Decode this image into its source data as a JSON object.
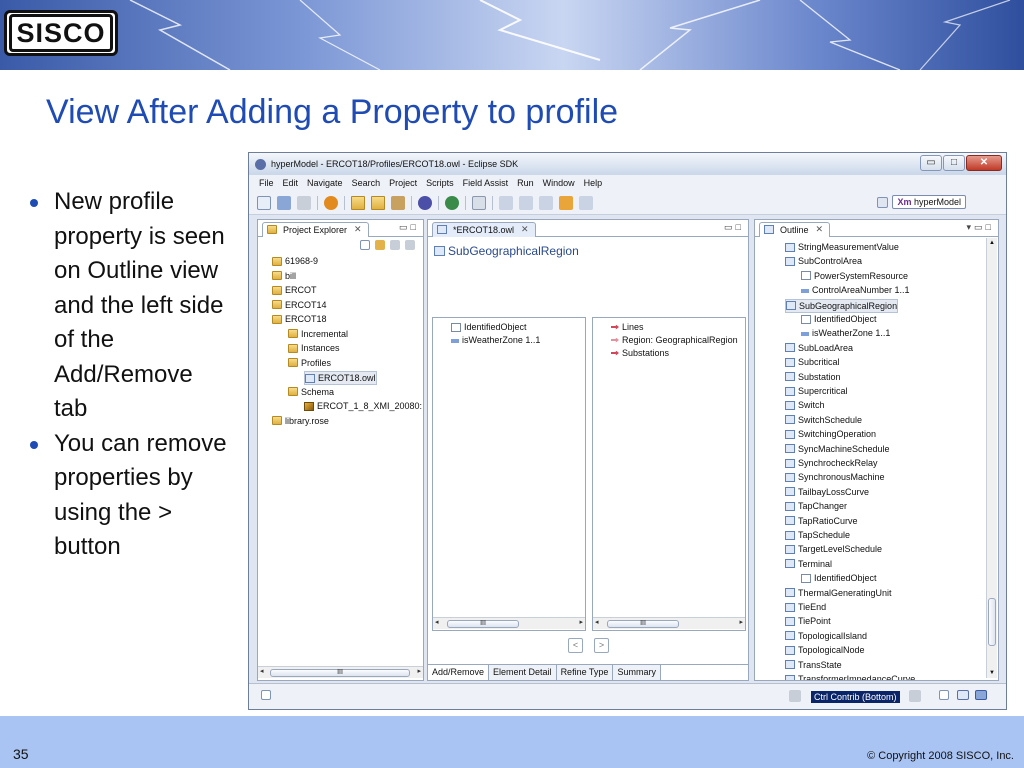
{
  "slide": {
    "title": "View After Adding a Property to profile",
    "bullets": [
      "New profile property is seen on Outline view and the left side of the Add/Remove tab",
      "You can remove properties by using the > button"
    ],
    "page_number": "35",
    "copyright": "© Copyright 2008 SISCO, Inc.",
    "logo_text": "SISCO"
  },
  "window": {
    "title": "hyperModel - ERCOT18/Profiles/ERCOT18.owl - Eclipse SDK",
    "menu": [
      "File",
      "Edit",
      "Navigate",
      "Search",
      "Project",
      "Scripts",
      "Field Assist",
      "Run",
      "Window",
      "Help"
    ],
    "perspective": "hyperModel",
    "perspective_prefix": "Xm",
    "status_tooltip": "Ctrl Contrib (Bottom)"
  },
  "project_explorer": {
    "tab_label": "Project Explorer",
    "tree": [
      {
        "label": "61968-9",
        "icon": "project-folder-icon",
        "depth": 0
      },
      {
        "label": "bill",
        "icon": "project-folder-icon",
        "depth": 0
      },
      {
        "label": "ERCOT",
        "icon": "project-folder-icon",
        "depth": 0
      },
      {
        "label": "ERCOT14",
        "icon": "project-folder-icon",
        "depth": 0
      },
      {
        "label": "ERCOT18",
        "icon": "project-folder-icon",
        "depth": 0
      },
      {
        "label": "Incremental",
        "icon": "folder-icon",
        "depth": 1
      },
      {
        "label": "Instances",
        "icon": "folder-icon",
        "depth": 1
      },
      {
        "label": "Profiles",
        "icon": "folder-icon",
        "depth": 1
      },
      {
        "label": "ERCOT18.owl",
        "icon": "owl-file-icon",
        "depth": 2
      },
      {
        "label": "Schema",
        "icon": "folder-icon",
        "depth": 1
      },
      {
        "label": "ERCOT_1_8_XMI_20080:",
        "icon": "model-cube-icon",
        "depth": 2
      },
      {
        "label": "library.rose",
        "icon": "project-folder-icon",
        "depth": 0
      }
    ],
    "scroll_thumb": "III"
  },
  "editor": {
    "tab_label": "*ERCOT18.owl",
    "class_name": "SubGeographicalRegion",
    "left_list": [
      "IdentifiedObject",
      "isWeatherZone 1..1"
    ],
    "right_list": [
      "Lines",
      "Region: GeographicalRegion",
      "Substations"
    ],
    "move_left": "<",
    "move_right": ">",
    "bottom_tabs": [
      "Add/Remove",
      "Element Detail",
      "Refine Type",
      "Summary"
    ],
    "scroll_thumb": "III"
  },
  "outline": {
    "tab_label": "Outline",
    "items": [
      {
        "label": "StringMeasurementValue",
        "depth": 0
      },
      {
        "label": "SubControlArea",
        "depth": 0
      },
      {
        "label": "PowerSystemResource",
        "depth": 1
      },
      {
        "label": "ControlAreaNumber 1..1",
        "depth": 1
      },
      {
        "label": "SubGeographicalRegion",
        "depth": 0
      },
      {
        "label": "IdentifiedObject",
        "depth": 1
      },
      {
        "label": "isWeatherZone 1..1",
        "depth": 1
      },
      {
        "label": "SubLoadArea",
        "depth": 0
      },
      {
        "label": "Subcritical",
        "depth": 0
      },
      {
        "label": "Substation",
        "depth": 0
      },
      {
        "label": "Supercritical",
        "depth": 0
      },
      {
        "label": "Switch",
        "depth": 0
      },
      {
        "label": "SwitchSchedule",
        "depth": 0
      },
      {
        "label": "SwitchingOperation",
        "depth": 0
      },
      {
        "label": "SyncMachineSchedule",
        "depth": 0
      },
      {
        "label": "SynchrocheckRelay",
        "depth": 0
      },
      {
        "label": "SynchronousMachine",
        "depth": 0
      },
      {
        "label": "TailbayLossCurve",
        "depth": 0
      },
      {
        "label": "TapChanger",
        "depth": 0
      },
      {
        "label": "TapRatioCurve",
        "depth": 0
      },
      {
        "label": "TapSchedule",
        "depth": 0
      },
      {
        "label": "TargetLevelSchedule",
        "depth": 0
      },
      {
        "label": "Terminal",
        "depth": 0
      },
      {
        "label": "IdentifiedObject",
        "depth": 1
      },
      {
        "label": "ThermalGeneratingUnit",
        "depth": 0
      },
      {
        "label": "TieEnd",
        "depth": 0
      },
      {
        "label": "TiePoint",
        "depth": 0
      },
      {
        "label": "TopologicalIsland",
        "depth": 0
      },
      {
        "label": "TopologicalNode",
        "depth": 0
      },
      {
        "label": "TransState",
        "depth": 0
      },
      {
        "label": "TransformerImpedanceCurve",
        "depth": 0
      }
    ]
  }
}
